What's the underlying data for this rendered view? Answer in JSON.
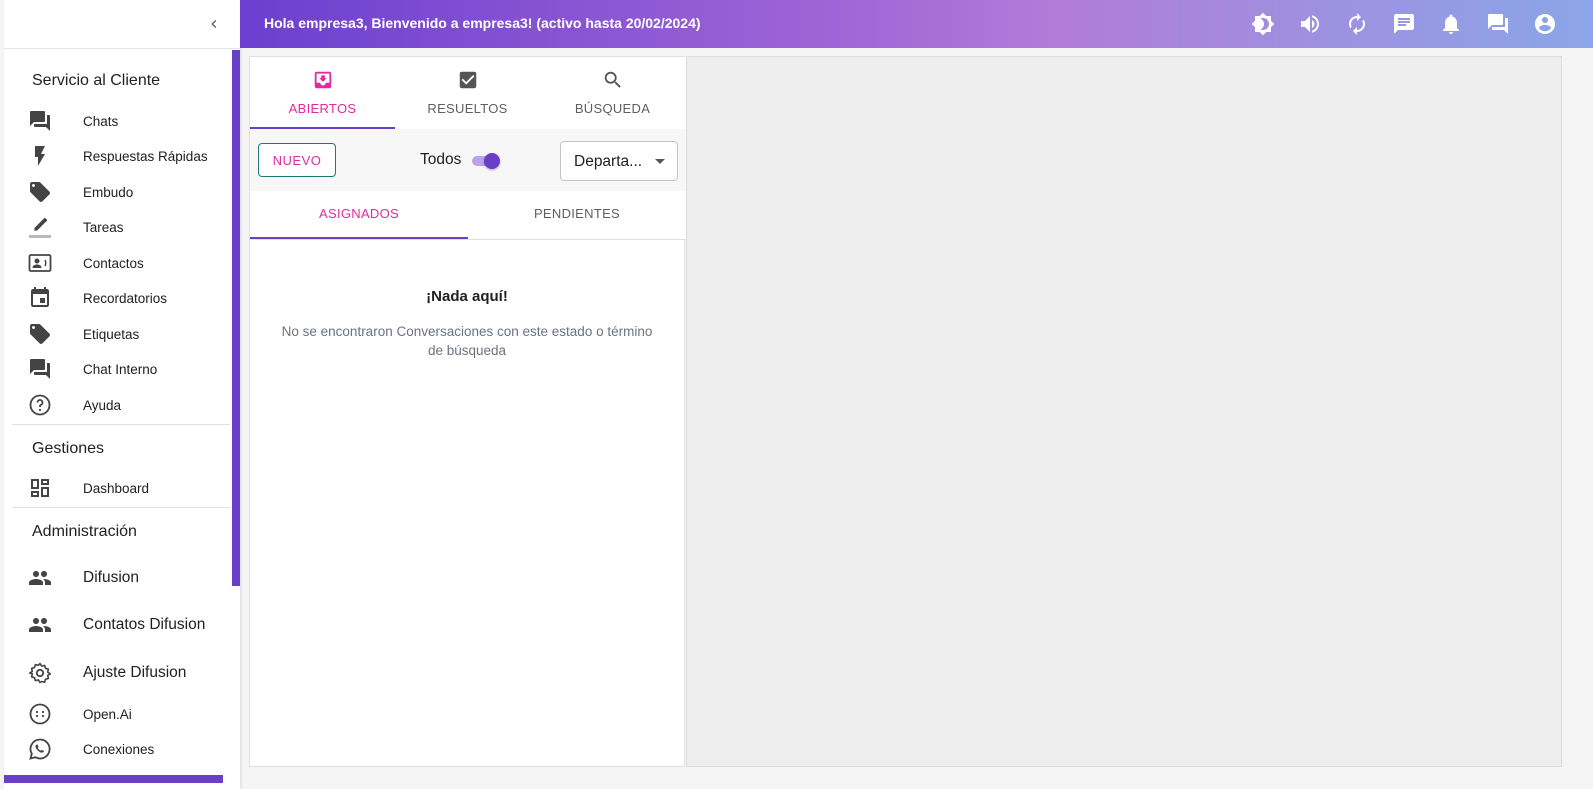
{
  "header": {
    "greeting": "Hola empresa3, Bienvenido a empresa3! (activo hasta 20/02/2024)",
    "icons": [
      "theme-toggle-icon",
      "volume-icon",
      "refresh-icon",
      "message-icon",
      "notifications-icon",
      "chat-bubbles-icon",
      "account-circle-icon"
    ]
  },
  "sidebar": {
    "sections": {
      "customer_service": "Servicio al Cliente",
      "management": "Gestiones",
      "administration": "Administración"
    },
    "items": [
      {
        "label": "Chats",
        "icon": "forum-icon"
      },
      {
        "label": "Respuestas Rápidas",
        "icon": "flash-icon"
      },
      {
        "label": "Embudo",
        "icon": "tag-icon"
      },
      {
        "label": "Tareas",
        "icon": "pencil-icon"
      },
      {
        "label": "Contactos",
        "icon": "contact-card-icon"
      },
      {
        "label": "Recordatorios",
        "icon": "calendar-icon"
      },
      {
        "label": "Etiquetas",
        "icon": "label-icon"
      },
      {
        "label": "Chat Interno",
        "icon": "forum-icon"
      },
      {
        "label": "Ayuda",
        "icon": "help-icon"
      },
      {
        "label": "Dashboard",
        "icon": "dashboard-icon"
      },
      {
        "label": "Difusion",
        "icon": "people-icon"
      },
      {
        "label": "Contatos Difusion",
        "icon": "people-icon"
      },
      {
        "label": "Ajuste Difusion",
        "icon": "gear-icon"
      },
      {
        "label": "Open.Ai",
        "icon": "openai-icon"
      },
      {
        "label": "Conexiones",
        "icon": "whatsapp-icon"
      }
    ]
  },
  "tickets": {
    "tabs": [
      {
        "label": "ABIERTOS",
        "icon": "inbox-icon",
        "active": true
      },
      {
        "label": "RESUELTOS",
        "icon": "check-box-icon",
        "active": false
      },
      {
        "label": "BÚSQUEDA",
        "icon": "search-icon",
        "active": false
      }
    ],
    "new_button": "NUEVO",
    "show_all_label": "Todos",
    "show_all_on": true,
    "department_select": "Departa...",
    "subtabs": [
      {
        "label": "ASIGNADOS",
        "active": true
      },
      {
        "label": "PENDIENTES",
        "active": false
      }
    ],
    "empty_title": "¡Nada aquí!",
    "empty_text": "No se encontraron Conversaciones con este estado o término de búsqueda"
  },
  "colors": {
    "accent": "#6a3fc7",
    "active_text": "#e02ba0",
    "button_border": "#1e7a70"
  }
}
